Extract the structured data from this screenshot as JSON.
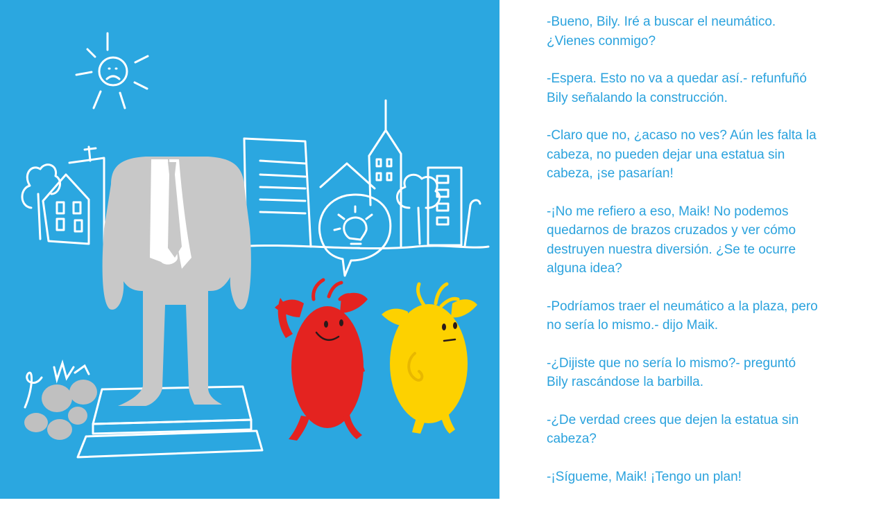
{
  "story": {
    "paragraphs": [
      "-Bueno, Bily. Iré a buscar el neumático.\n¿Vienes conmigo?",
      "-Espera. Esto no va a quedar así.- refunfuñó\nBily señalando la construcción.",
      "-Claro que no, ¿acaso no ves? Aún les falta la\ncabeza, no pueden dejar una estatua sin\ncabeza, ¡se pasarían!",
      "-¡No me refiero a eso, Maik! No podemos\nquedarnos de brazos cruzados y ver cómo\ndestruyen nuestra diversión. ¿Se te ocurre\nalguna idea?",
      "-Podríamos traer el neumático a la plaza, pero\nno sería lo mismo.- dijo Maik.",
      "-¿Dijiste que no sería lo mismo?- preguntó\nBily rascándose la barbilla.",
      "-¿De verdad crees que dejen la estatua sin\ncabeza?",
      "-¡Sígueme, Maik! ¡Tengo un plan!"
    ]
  },
  "colors": {
    "illustration_background": "#2ba7e0",
    "text": "#2aa2dd",
    "statue": "#c8c8c8",
    "bily": "#e42320",
    "maik": "#fdd100"
  }
}
